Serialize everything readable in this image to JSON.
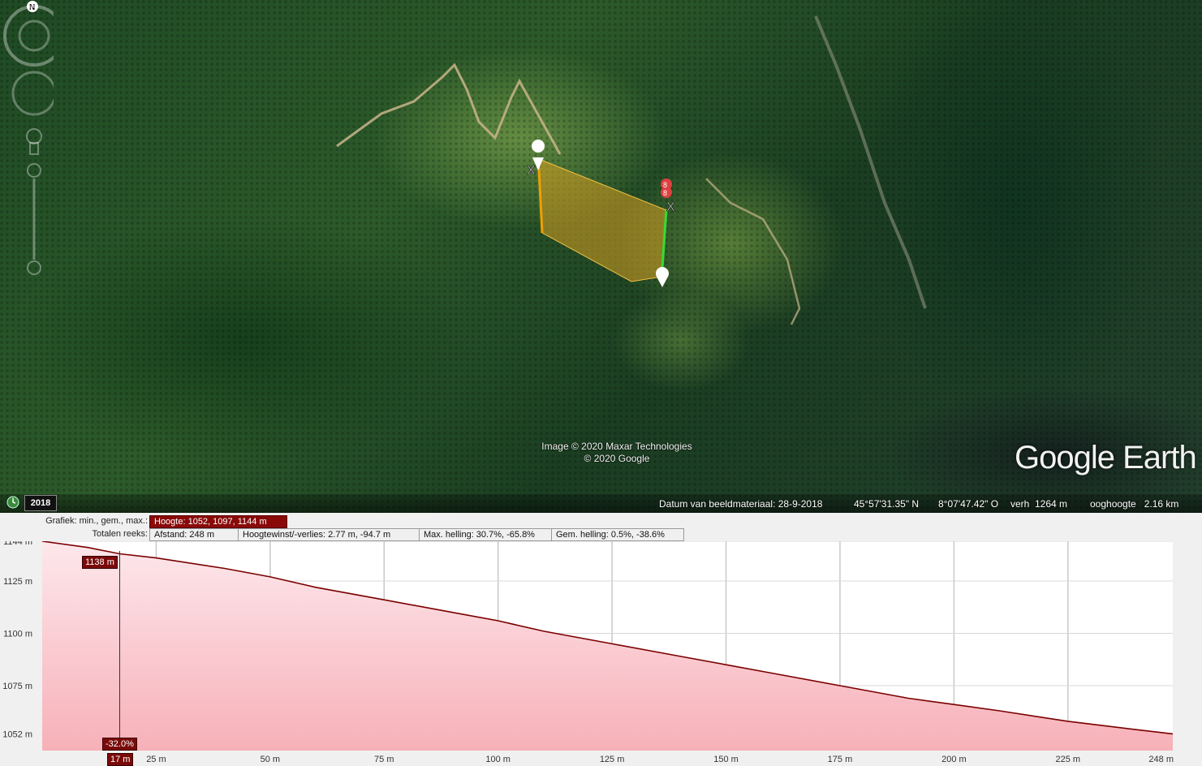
{
  "imagery": {
    "attribution_line1": "Image © 2020 Maxar Technologies",
    "attribution_line2": "© 2020 Google",
    "logo": "Google Earth",
    "compass_letter": "N"
  },
  "status": {
    "year": "2018",
    "date_label": "Datum van beeldmateriaal: 28-9-2018",
    "lat": "45°57'31.35\" N",
    "lon": "8°07'47.42\" O",
    "elev": "verh  1264 m",
    "eye": "ooghoogte   2.16 km"
  },
  "profile_info": {
    "graph_label": "Grafiek: min., gem., max.:",
    "height_value": "Hoogte: 1052, 1097, 1144 m",
    "totals_label": "Totalen reeks:",
    "distance": "Afstand: 248 m",
    "gain_loss": "Hoogtewinst/-verlies: 2.77 m, -94.7 m",
    "max_slope": "Max. helling: 30.7%, -65.8%",
    "avg_slope": "Gem. helling: 0.5%, -38.6%"
  },
  "cursor": {
    "distance_value": 17,
    "distance_label": "17 m",
    "elevation_label": "1138 m",
    "slope_label": "-32.0%"
  },
  "colors": {
    "fill_top": "#fde8ec",
    "fill_bottom": "#f7b0b8",
    "line": "#7a0000",
    "polygon": "#d9a020",
    "path_green": "#33dd33",
    "path_orange": "#f0a000"
  },
  "chart_data": {
    "type": "area",
    "xlabel": "",
    "ylabel": "",
    "xlim": [
      0,
      248
    ],
    "ylim": [
      1044,
      1144
    ],
    "x_ticks": [
      25,
      50,
      75,
      100,
      125,
      150,
      175,
      200,
      225
    ],
    "x_tick_labels": [
      "25 m",
      "50 m",
      "75 m",
      "100 m",
      "125 m",
      "150 m",
      "175 m",
      "200 m",
      "225 m"
    ],
    "x_end_label": "248 m",
    "y_ticks": [
      1052,
      1075,
      1100,
      1125,
      1144
    ],
    "y_tick_labels": [
      "1052 m",
      "1075 m",
      "1100 m",
      "1125 m",
      "1144 m"
    ],
    "series": [
      {
        "x": [
          0,
          10,
          17,
          25,
          40,
          50,
          60,
          75,
          90,
          100,
          110,
          125,
          140,
          150,
          160,
          175,
          190,
          200,
          210,
          225,
          240,
          248
        ],
        "y": [
          1144,
          1141,
          1138,
          1136,
          1131,
          1127,
          1122,
          1116,
          1110,
          1106,
          1101,
          1095,
          1089,
          1085,
          1081,
          1075,
          1069,
          1066,
          1063,
          1058,
          1054,
          1052
        ]
      }
    ],
    "grid": true
  }
}
